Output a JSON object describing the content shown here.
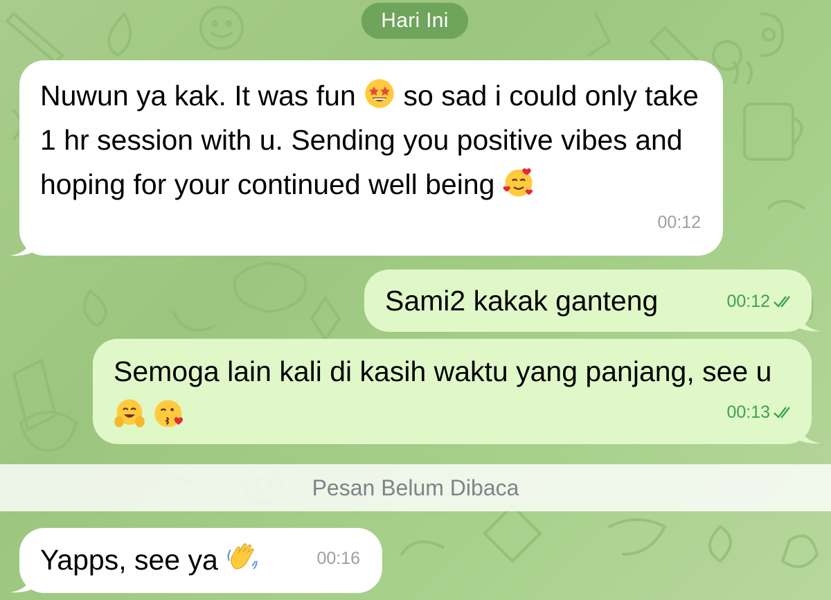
{
  "date_label": "Hari Ini",
  "messages": [
    {
      "direction": "incoming",
      "text_parts": [
        "Nuwun ya kak. It was fun ",
        " so sad i could only take 1 hr session with u. Sending you positive vibes and hoping for your continued well being "
      ],
      "emoji": [
        "star-struck",
        "smiling-face-with-hearts"
      ],
      "time": "00:12"
    },
    {
      "direction": "outgoing",
      "text": "Sami2 kakak ganteng",
      "time": "00:12",
      "status": "read"
    },
    {
      "direction": "outgoing",
      "text_parts": [
        "Semoga lain kali di kasih waktu yang panjang, see u ",
        " "
      ],
      "emoji": [
        "hugging-face",
        "face-blowing-kiss"
      ],
      "time": "00:13",
      "status": "read"
    },
    {
      "direction": "incoming",
      "text": "Yapps, see ya ",
      "emoji": [
        "waving-hand"
      ],
      "time": "00:16"
    }
  ],
  "unread_label": "Pesan Belum Dibaca",
  "colors": {
    "background": "#a6cc8a",
    "date_pill": "#6ea45b",
    "incoming_bubble": "#ffffff",
    "outgoing_bubble": "#e0f8c8",
    "outgoing_meta": "#3fa24a",
    "incoming_meta": "#9aa0a6"
  }
}
